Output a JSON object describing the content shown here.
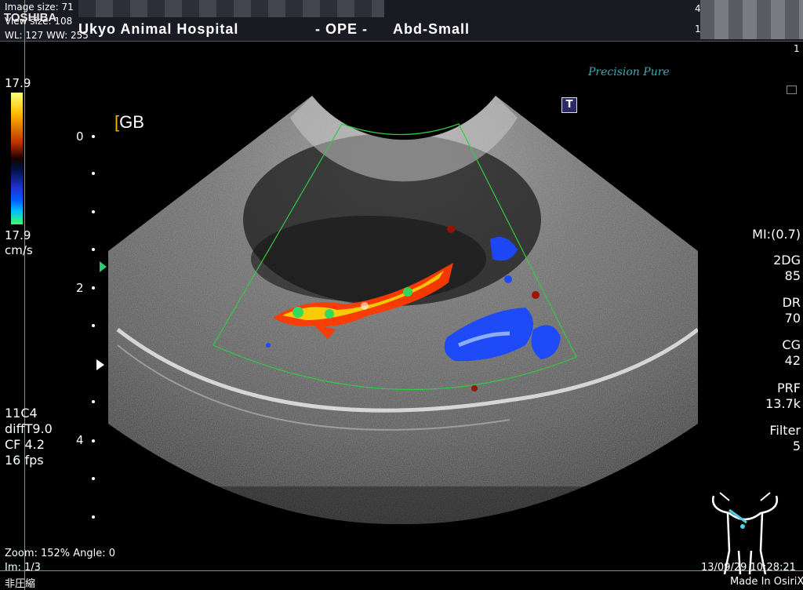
{
  "header": {
    "vendor_logo": "TOSHIBA",
    "hospital_name": "Ukyo Animal Hospital",
    "mode": "- OPE -",
    "preset": "Abd-Small",
    "image_size": "Image size: 71",
    "view_size": "View size: 108",
    "wl_ww": "WL: 127 WW: 255",
    "corner_top": "4",
    "corner_mid": "1",
    "corner_right": "1"
  },
  "logo": {
    "text": "Precision  Pure"
  },
  "t_marker": "T",
  "color_scale": {
    "top_value": "17.9",
    "bottom_value": "17.9",
    "unit": "cm/s"
  },
  "depth_scale": {
    "labels": [
      "0",
      "2",
      "4"
    ]
  },
  "anatomy_label": "GB",
  "right_params": {
    "mi": "MI:(0.7)",
    "gain_label": "2DG",
    "gain_value": "85",
    "dr_label": "DR",
    "dr_value": "70",
    "cg_label": "CG",
    "cg_value": "42",
    "prf_label": "PRF",
    "prf_value": "13.7k",
    "filter_label": "Filter",
    "filter_value": "5"
  },
  "left_params": {
    "probe": "11C4",
    "harmonic": "diffT9.0",
    "cf": "CF 4.2",
    "fps": "16 fps"
  },
  "footer": {
    "zoom": "Zoom: 152%  Angle: 0",
    "image_index": "Im: 1/3",
    "note": "非圧縮",
    "timestamp": "13/09/29 10:28:21",
    "made_in": "Made In OsiriX"
  },
  "colors": {
    "overlay_green": "#2ecc40",
    "flow_red": "#ff3000",
    "flow_blue": "#1040ff"
  }
}
